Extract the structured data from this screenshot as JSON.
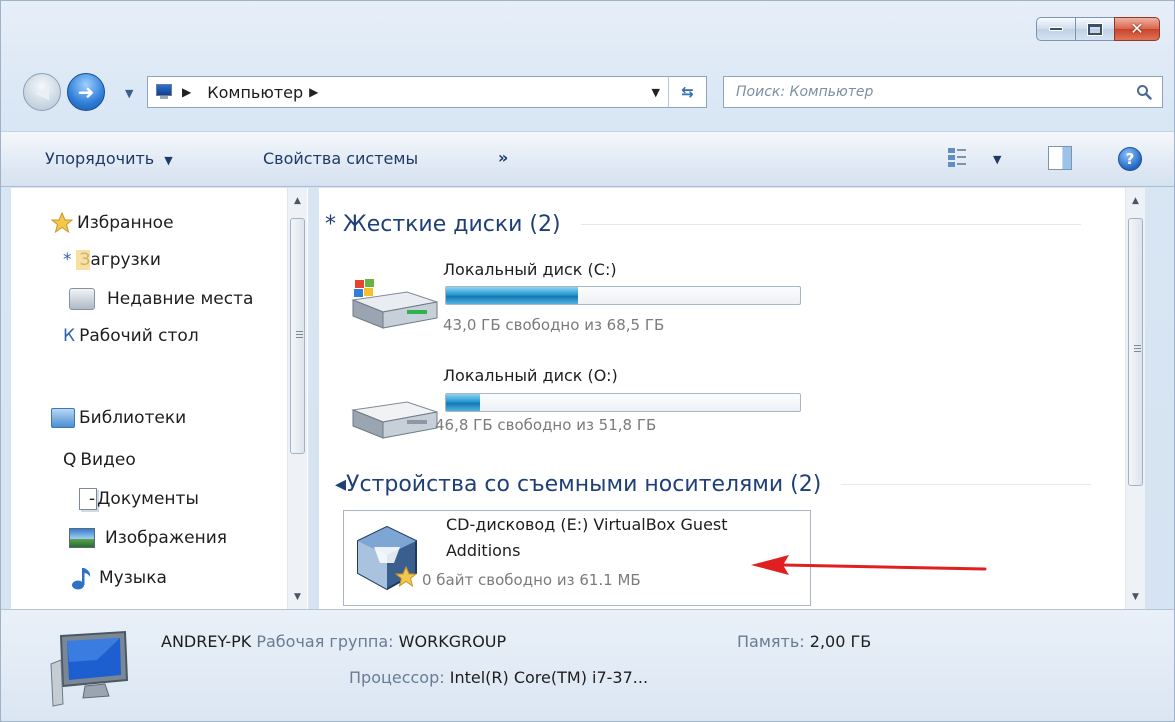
{
  "address": {
    "segments": [
      "Компьютер"
    ],
    "search_placeholder": "Поиск: Компьютер"
  },
  "toolbar": {
    "organize_label": "Упорядочить",
    "system_props_label": "Свойства системы",
    "more_label": "»"
  },
  "nav": {
    "favorites": "Избранное",
    "downloads_prefix": "*",
    "downloads": "Загрузки",
    "recent": "Недавние места",
    "desktop_prefix": "К",
    "desktop": "Рабочий стол",
    "libraries": "Библиотеки",
    "video_prefix": "Q",
    "video": "Видео",
    "documents_prefix": "-",
    "documents": "Документы",
    "images": "Изображения",
    "music": "Музыка"
  },
  "content": {
    "hdd_group": "* Жесткие диски (2)",
    "removable_group": "◂Устройства со съемными носителями (2)",
    "drives": [
      {
        "name": "Локальный диск (C:)",
        "free_text": "43,0 ГБ свободно из 68,5 ГБ",
        "used_fraction": 0.372
      },
      {
        "name": "Локальный диск (O:)",
        "free_text": "46,8 ГБ свободно из 51,8 ГБ",
        "used_fraction": 0.097
      }
    ],
    "cd": {
      "name_line1": "CD-дисковод (E:) VirtualBox Guest",
      "name_line2": "Additions",
      "free_text": "0 байт свободно из 61.1 МБ"
    }
  },
  "details": {
    "pc_name": "ANDREY-PK",
    "workgroup_label": "Рабочая группа:",
    "workgroup_value": "WORKGROUP",
    "memory_label": "Память:",
    "memory_value": "2,00 ГБ",
    "cpu_label": "Процессор:",
    "cpu_value": "Intel(R) Core(TM) i7-37..."
  },
  "colors": {
    "accent_text": "#1f3f78",
    "progress_fill": "#2798cf",
    "annotation_arrow": "#e02020"
  }
}
